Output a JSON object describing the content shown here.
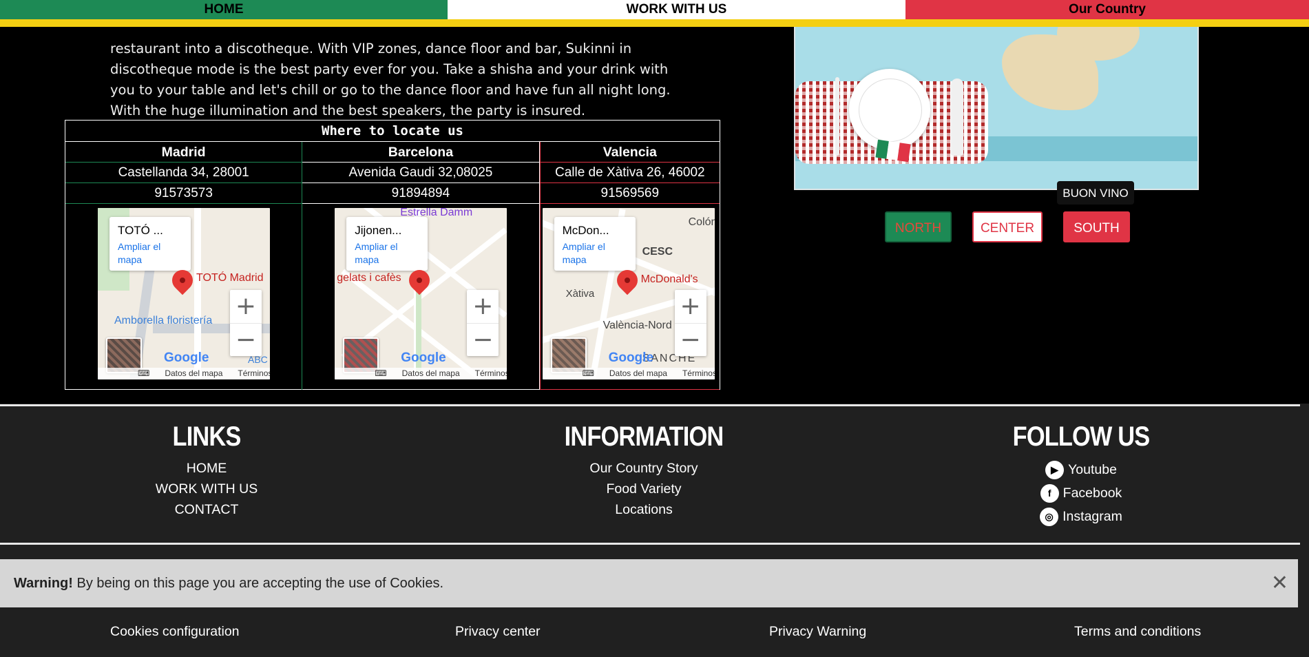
{
  "nav": {
    "home": "HOME",
    "work": "WORK WITH US",
    "country": "Our Country"
  },
  "intro": {
    "text": "restaurant into a discotheque. With VIP zones, dance floor and bar, Sukinni in discotheque mode is the best party ever for you. Take a shisha and your drink with you to your table and let's chill or go to the dance floor and have fun all night long. With the huge illumination and the best speakers, the party is insured."
  },
  "locations": {
    "title": "Where to locate us",
    "cities": [
      {
        "name": "Madrid",
        "address": "Castellanda 34, 28001",
        "phone": "91573573",
        "map": {
          "place": "TOTÓ ...",
          "enlarge": "Ampliar el mapa",
          "labels": [
            "TOTÓ Madrid",
            "Amborella floristería",
            "ABC"
          ]
        }
      },
      {
        "name": "Barcelona",
        "address": "Avenida Gaudi 32,08025",
        "phone": "91894894",
        "map": {
          "place": "Jijonen...",
          "enlarge": "Ampliar el mapa",
          "labels": [
            "Estrella Damm",
            "gelats i cafès"
          ]
        }
      },
      {
        "name": "Valencia",
        "address": "Calle de Xàtiva 26, 46002",
        "phone": "91569569",
        "map": {
          "place": "McDon...",
          "enlarge": "Ampliar el mapa",
          "labels": [
            "McDonald's",
            "Xàtiva",
            "València-Nord",
            "Colón",
            "CESC",
            "SANCHE"
          ]
        }
      }
    ],
    "map_footer": {
      "keyboard": "⌨",
      "data": "Datos del mapa",
      "terms": "Términos",
      "google": "Google"
    }
  },
  "region": {
    "tooltip": "BUON VINO",
    "north": "NORTH",
    "center": "CENTER",
    "south": "SOUTH"
  },
  "footer": {
    "links": {
      "title": "LINKS",
      "items": [
        "HOME",
        "WORK WITH US",
        "CONTACT"
      ]
    },
    "information": {
      "title": "INFORMATION",
      "items": [
        "Our Country Story",
        "Food Variety",
        "Locations"
      ]
    },
    "follow": {
      "title": "FOLLOW US",
      "items": [
        "Youtube",
        "Facebook",
        "Instagram"
      ]
    }
  },
  "cookie": {
    "strong": "Warning!",
    "text": " By being on this page you are accepting the use of Cookies.",
    "close": "✕"
  },
  "legal": {
    "config": "Cookies configuration",
    "privacy_center": "Privacy center",
    "privacy_warning": "Privacy Warning",
    "terms": "Terms and conditions"
  },
  "colors": {
    "green": "#1d8a55",
    "red": "#e03445",
    "yellow": "#f4cf12"
  }
}
